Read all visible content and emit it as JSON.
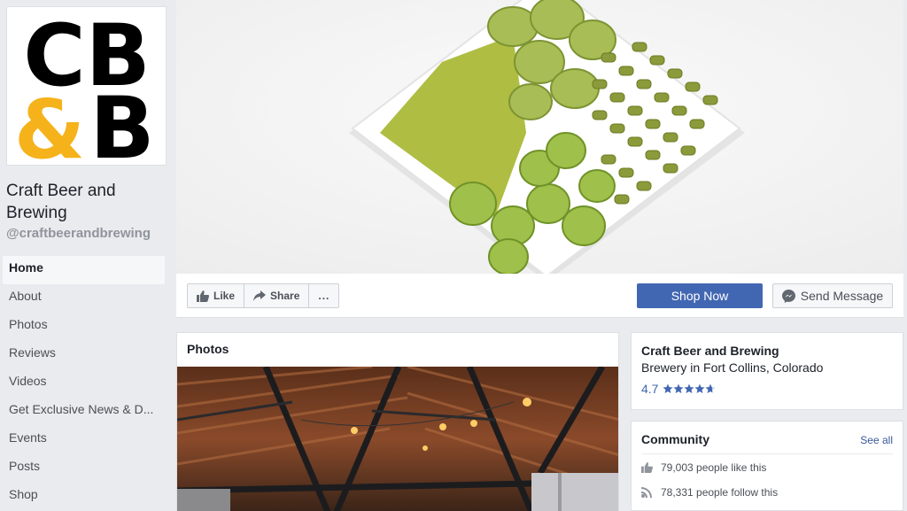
{
  "logo": {
    "line1": "CB",
    "line2_amp": "&",
    "line2_b": "B",
    "colors": {
      "text": "#000000",
      "amp": "#f5b21a"
    }
  },
  "page": {
    "name": "Craft Beer and Brewing",
    "handle": "@craftbeerandbrewing"
  },
  "nav": {
    "items": [
      {
        "label": "Home",
        "active": true
      },
      {
        "label": "About"
      },
      {
        "label": "Photos"
      },
      {
        "label": "Reviews"
      },
      {
        "label": "Videos"
      },
      {
        "label": "Get Exclusive News & D..."
      },
      {
        "label": "Events"
      },
      {
        "label": "Posts"
      },
      {
        "label": "Shop"
      }
    ]
  },
  "cover": {
    "image": "hops-tray-photo"
  },
  "actions": {
    "like": "Like",
    "share": "Share",
    "more": "...",
    "shop_now": "Shop Now",
    "send_message": "Send Message"
  },
  "photos": {
    "title": "Photos",
    "image": "brewery-interior-photo"
  },
  "info": {
    "name": "Craft Beer and Brewing",
    "category": "Brewery in Fort Collins, Colorado",
    "rating": "4.7",
    "rating_stars": 4.7
  },
  "community": {
    "title": "Community",
    "see_all": "See all",
    "likes": "79,003 people like this",
    "follows": "78,331 people follow this"
  },
  "colors": {
    "brand_blue": "#4267b2",
    "link": "#385898",
    "background": "#e9ebee"
  }
}
